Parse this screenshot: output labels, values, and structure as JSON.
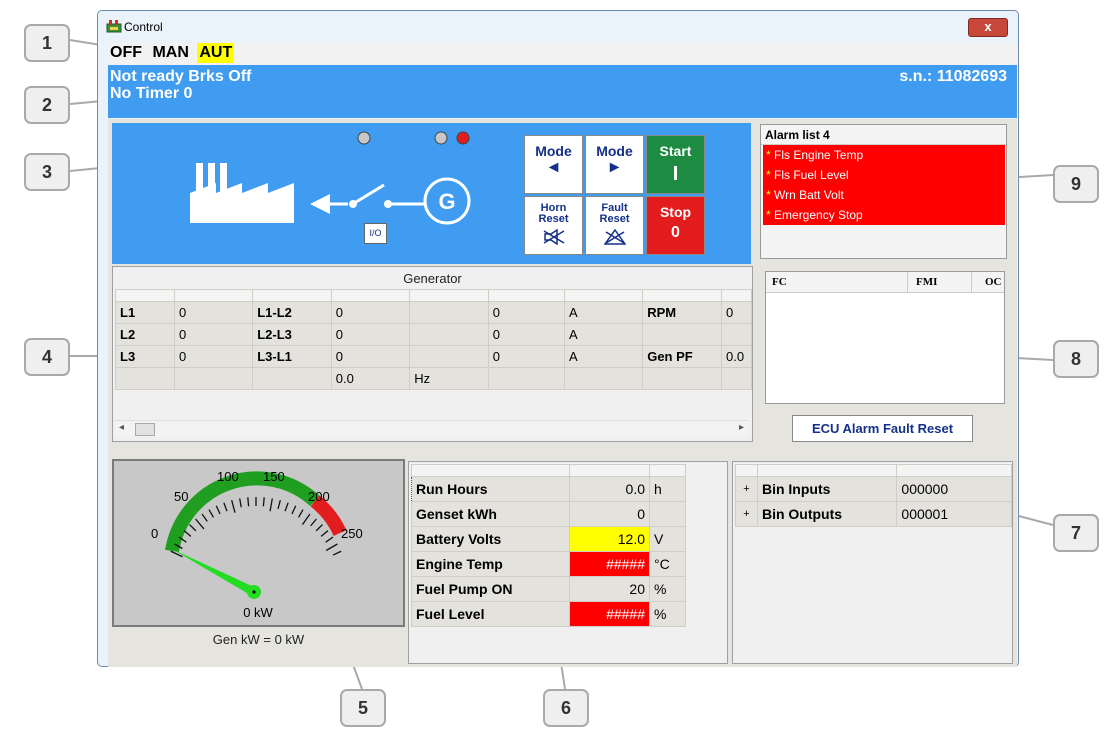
{
  "window": {
    "title": "Control",
    "close_label": "x"
  },
  "modes": [
    {
      "label": "OFF",
      "active": false
    },
    {
      "label": "MAN",
      "active": false
    },
    {
      "label": "AUT",
      "active": true
    }
  ],
  "status": {
    "line1": "Not ready Brks Off",
    "line2": "No Timer 0",
    "serial": "s.n.: 11082693"
  },
  "diagram": {
    "breaker_label": "I/O",
    "generator_label": "G"
  },
  "controls": {
    "mode_left": {
      "label": "Mode",
      "glyph": "◄"
    },
    "mode_right": {
      "label": "Mode",
      "glyph": "►"
    },
    "start": {
      "label": "Start",
      "glyph": "I"
    },
    "horn_reset": {
      "label1": "Horn",
      "label2": "Reset"
    },
    "fault_reset": {
      "label1": "Fault",
      "label2": "Reset"
    },
    "stop": {
      "label": "Stop",
      "glyph": "0"
    }
  },
  "alarm_list": {
    "title": "Alarm list 4",
    "items": [
      "Fls Engine Temp",
      "Fls Fuel Level",
      "Wrn Batt Volt",
      "Emergency Stop"
    ]
  },
  "generator": {
    "title": "Generator",
    "rows": [
      [
        "L1",
        "0",
        "L1-L2",
        "0",
        "",
        "0",
        "A",
        "RPM",
        "0"
      ],
      [
        "L2",
        "0",
        "L2-L3",
        "0",
        "",
        "0",
        "A",
        "",
        ""
      ],
      [
        "L3",
        "0",
        "L3-L1",
        "0",
        "",
        "0",
        "A",
        "Gen PF",
        "0.0"
      ],
      [
        "",
        "",
        "",
        "0.0",
        "Hz",
        "",
        "",
        "",
        ""
      ]
    ]
  },
  "fault_codes": {
    "columns": [
      "FC",
      "FMI",
      "OC"
    ],
    "reset_button": "ECU Alarm Fault Reset"
  },
  "gauge": {
    "ticks": [
      "0",
      "50",
      "100",
      "150",
      "200",
      "250"
    ],
    "value": 0,
    "unit_label": "0 kW",
    "caption": "Gen kW = 0 kW"
  },
  "values": [
    {
      "name": "Run Hours",
      "value": "0.0",
      "unit": "h",
      "state": "normal"
    },
    {
      "name": "Genset kWh",
      "value": "0",
      "unit": "",
      "state": "normal"
    },
    {
      "name": "Battery Volts",
      "value": "12.0",
      "unit": "V",
      "state": "warning"
    },
    {
      "name": "Engine Temp",
      "value": "#####",
      "unit": "°C",
      "state": "alarm"
    },
    {
      "name": "Fuel Pump ON",
      "value": "20",
      "unit": "%",
      "state": "normal"
    },
    {
      "name": "Fuel Level",
      "value": "#####",
      "unit": "%",
      "state": "alarm"
    }
  ],
  "bins": [
    {
      "name": "Bin Inputs",
      "value": "000000",
      "expand": "+"
    },
    {
      "name": "Bin Outputs",
      "value": "000001",
      "expand": "+"
    }
  ],
  "callouts": [
    "1",
    "2",
    "3",
    "4",
    "5",
    "6",
    "7",
    "8",
    "9"
  ],
  "colors": {
    "status_blue": "#3f9cf0",
    "alarm_red": "#ff0000",
    "warn_yellow": "#ffff00",
    "start_green": "#1e8b43"
  }
}
